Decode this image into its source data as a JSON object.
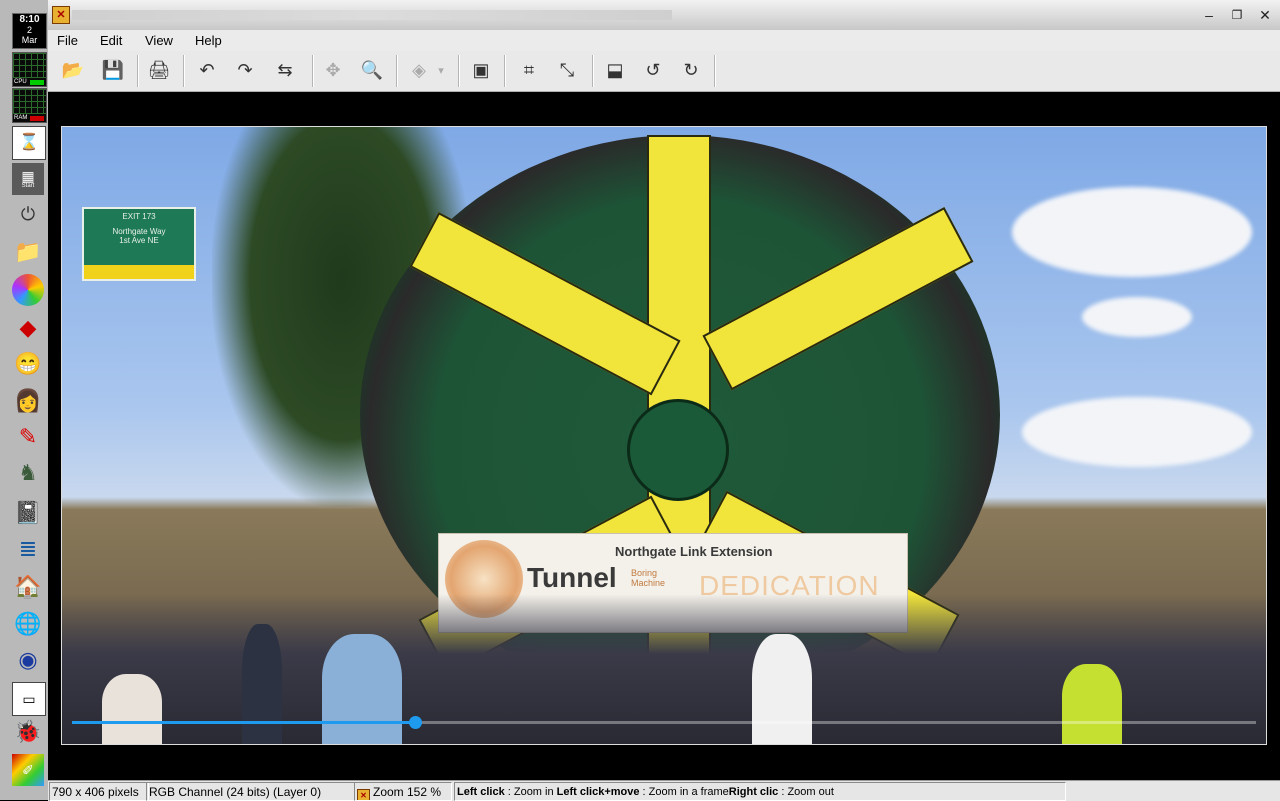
{
  "dock": {
    "clock_time": "8:10",
    "clock_day": "2",
    "clock_month": "Mar",
    "meters": [
      {
        "label": "CPU"
      },
      {
        "label": "RAM"
      }
    ],
    "start_label": "Start",
    "icons": [
      "hourglass-icon",
      "start-icon",
      "power-icon",
      "folder-icon",
      "color-wheel-icon",
      "kite-icon",
      "smiley-icon",
      "character-icon",
      "brush-icon",
      "knight-icon",
      "notebook-icon",
      "document-icon",
      "house-icon",
      "globe-icon",
      "globe-blue-icon",
      "window-icon",
      "bug-icon",
      "paint-icon"
    ]
  },
  "window": {
    "title": ""
  },
  "menu": {
    "items": [
      "File",
      "Edit",
      "View",
      "Help"
    ]
  },
  "toolbar": {
    "tools": [
      {
        "name": "open-icon",
        "glyph": "📂",
        "disabled": false
      },
      {
        "name": "save-icon",
        "glyph": "💾",
        "disabled": true
      },
      {
        "name": "print-icon",
        "glyph": "🖨",
        "disabled": false
      },
      {
        "name": "undo-icon",
        "glyph": "↶",
        "disabled": false
      },
      {
        "name": "redo-icon",
        "glyph": "↷",
        "disabled": false
      },
      {
        "name": "repeat-icon",
        "glyph": "⇆",
        "disabled": false
      },
      {
        "name": "move-icon",
        "glyph": "✥",
        "disabled": true
      },
      {
        "name": "magnifier-icon",
        "glyph": "🔍",
        "disabled": false
      },
      {
        "name": "layers-icon",
        "glyph": "◈",
        "disabled": true
      },
      {
        "name": "layers-dropdown-icon",
        "glyph": "▾",
        "disabled": true
      },
      {
        "name": "fullscreen-icon",
        "glyph": "▣",
        "disabled": false
      },
      {
        "name": "crop-icon",
        "glyph": "⌗",
        "disabled": false
      },
      {
        "name": "resize-icon",
        "glyph": "⤡",
        "disabled": false
      },
      {
        "name": "flip-icon",
        "glyph": "⬓",
        "disabled": false
      },
      {
        "name": "rotate-left-icon",
        "glyph": "↺",
        "disabled": false
      },
      {
        "name": "rotate-right-icon",
        "glyph": "↻",
        "disabled": false
      }
    ]
  },
  "image": {
    "sign_line1": "EXIT 173",
    "sign_line2": "Northgate Way",
    "sign_line3": "1st Ave NE",
    "banner_line1": "Northgate Link Extension",
    "banner_line2": "Tunnel",
    "banner_line3": "Boring Machine",
    "banner_line4": "DEDICATION",
    "progress": 0.29
  },
  "status": {
    "dimensions": "790 x 406 pixels",
    "channel": "RGB Channel (24 bits) (Layer 0)",
    "zoom": "Zoom 152 %",
    "hint_left_click": "Left click",
    "hint_left_click_text": " : Zoom in ",
    "hint_left_move": "Left click+move",
    "hint_left_move_text": " : Zoom in a frame",
    "hint_right": "Right clic",
    "hint_right_text": " : Zoom out"
  },
  "colors": {
    "accent": "#1e9bef",
    "machine_green": "#1d5436",
    "machine_yellow": "#f1e43a"
  }
}
